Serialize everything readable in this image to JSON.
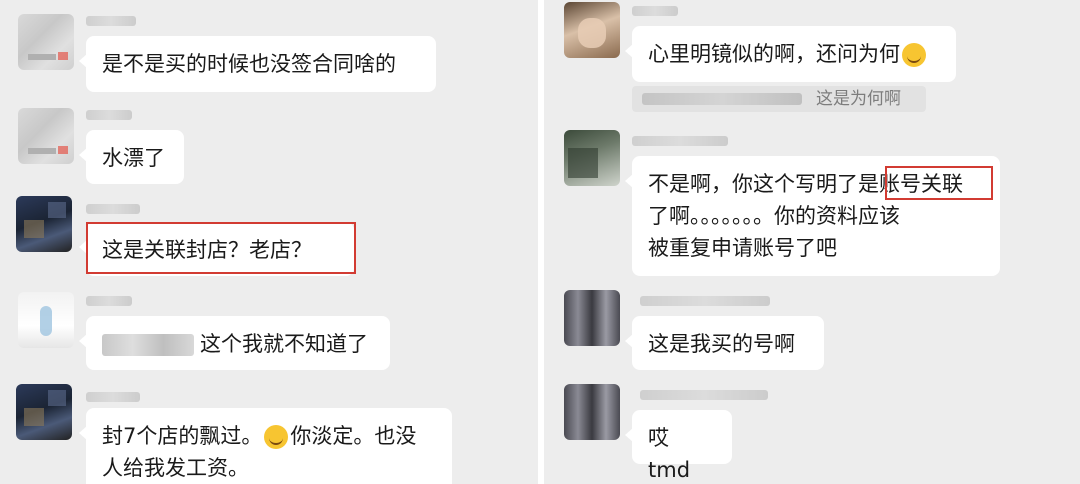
{
  "left_chat": {
    "messages": [
      {
        "text": "是不是买的时候也没签合同啥的"
      },
      {
        "text": "水漂了"
      },
      {
        "text": "这是关联封店？老店？"
      },
      {
        "text": "这个我就不知道了"
      },
      {
        "text_line1_a": "封7个店的飘过。",
        "text_line1_b": "你淡定。也没",
        "text_line2": "人给我发工资。",
        "emoji": "laughing-tears-emoji"
      }
    ]
  },
  "right_chat": {
    "messages": [
      {
        "text": "心里明镜似的啊，还问为何",
        "emoji": "thinking-face-emoji"
      },
      {
        "quote": "这是为何啊"
      },
      {
        "line1_a": "不是啊，你这个写明了是",
        "line1_highlight": "账号关联",
        "line2": "了啊。。。。。。。你的资料应该",
        "line3": "被重复申请账号了吧"
      },
      {
        "text": "这是我买的号啊"
      },
      {
        "text": "哎 tmd"
      }
    ]
  },
  "colors": {
    "chat_background": "#ededed",
    "bubble": "#ffffff",
    "highlight_box": "#d23b32",
    "divider": "#ffffff"
  }
}
